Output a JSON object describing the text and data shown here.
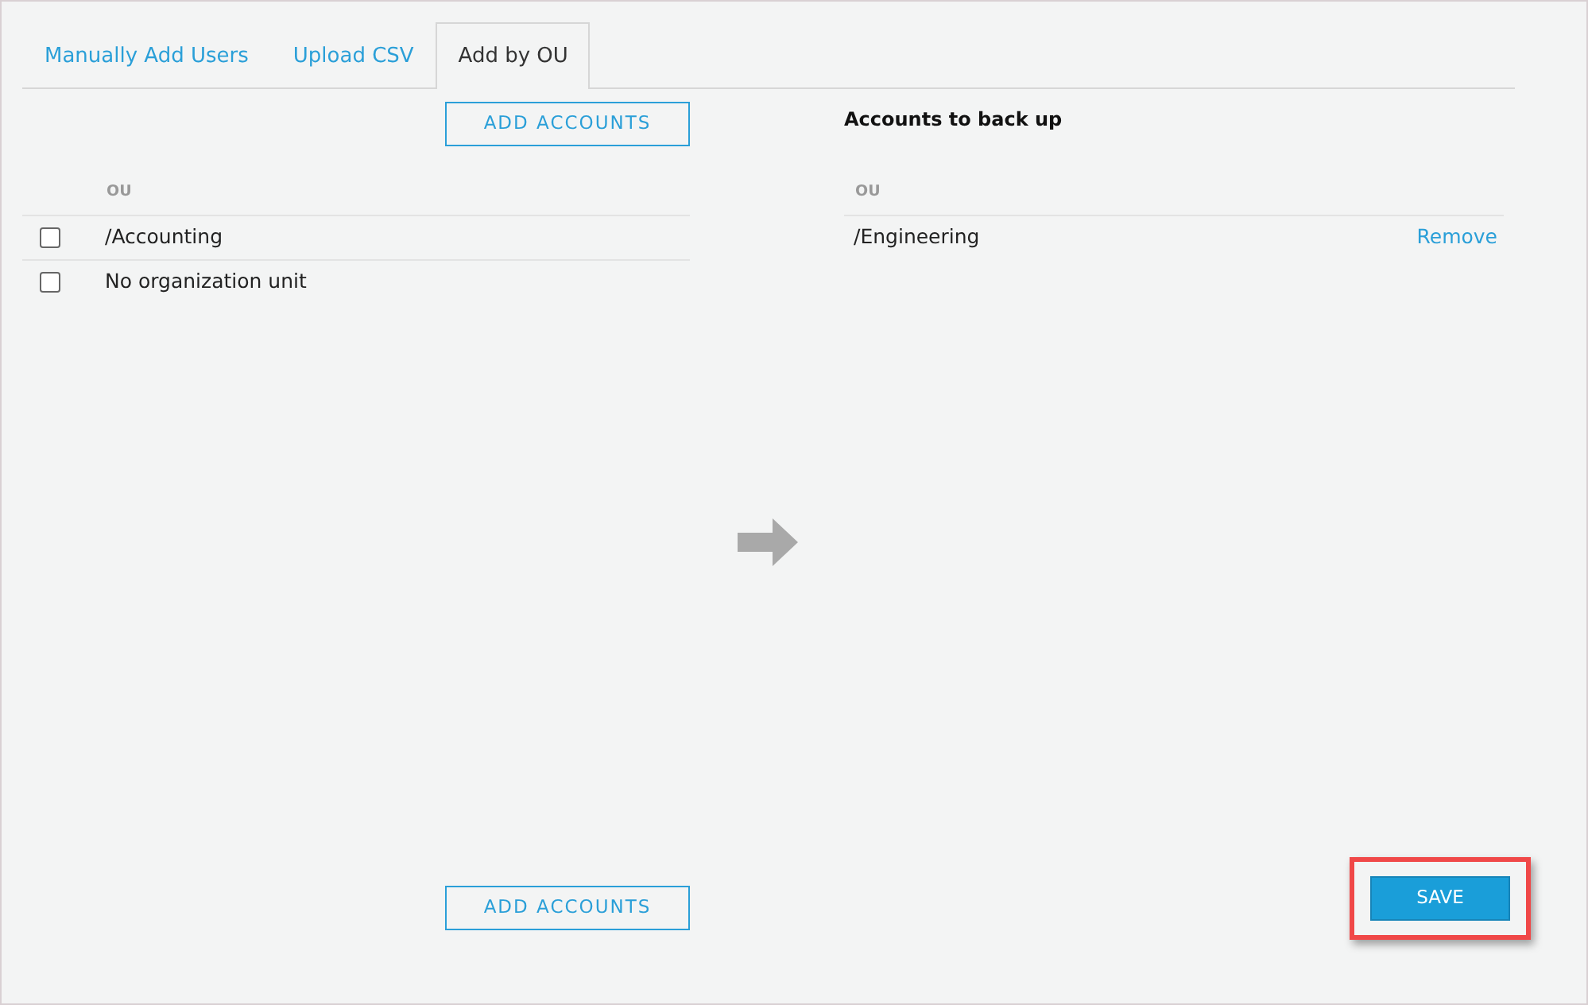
{
  "tabs": [
    {
      "label": "Manually Add Users",
      "selected": false
    },
    {
      "label": "Upload CSV",
      "selected": false
    },
    {
      "label": "Add by OU",
      "selected": true
    }
  ],
  "available": {
    "top_button": "ADD ACCOUNTS",
    "column": "OU",
    "rows": [
      {
        "label": "/Accounting",
        "checked": false
      },
      {
        "label": "No organization unit",
        "checked": false
      }
    ],
    "bottom_button": "ADD ACCOUNTS"
  },
  "selected_accounts": {
    "title": "Accounts to back up",
    "column": "OU",
    "rows": [
      {
        "label": "/Engineering",
        "action": "Remove"
      }
    ]
  },
  "save_button": {
    "label": "SAVE",
    "highlighted": true
  }
}
